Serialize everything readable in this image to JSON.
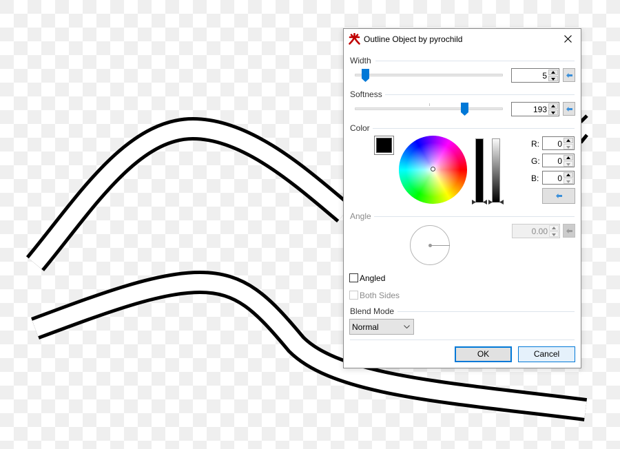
{
  "dialog": {
    "title": "Outline Object by pyrochild",
    "icons": {
      "app": "pyrochild-flame-icon",
      "close": "close-icon"
    }
  },
  "width": {
    "label": "Width",
    "value": "5",
    "slider_fraction": 0.05,
    "reset_icon": "arrow-left-icon"
  },
  "softness": {
    "label": "Softness",
    "value": "193",
    "slider_fraction": 0.755,
    "reset_icon": "arrow-left-icon"
  },
  "color": {
    "label": "Color",
    "swatch_hex": "#000000",
    "r_label": "R:",
    "g_label": "G:",
    "b_label": "B:",
    "r_value": "0",
    "g_value": "0",
    "b_value": "0",
    "reset_icon": "arrow-left-icon"
  },
  "angle": {
    "label": "Angle",
    "value": "0.00",
    "disabled": true,
    "reset_icon": "arrow-left-icon"
  },
  "angled": {
    "label": "Angled",
    "checked": false
  },
  "both_sides": {
    "label": "Both Sides",
    "checked": false,
    "disabled": true
  },
  "blend_mode": {
    "label": "Blend Mode",
    "selected": "Normal"
  },
  "buttons": {
    "ok": "OK",
    "cancel": "Cancel"
  },
  "colors": {
    "accent": "#0078d7",
    "app_icon_red": "#c00000",
    "checker_light": "#ffffff",
    "checker_dark": "#efefef",
    "stroke": "#000000"
  }
}
